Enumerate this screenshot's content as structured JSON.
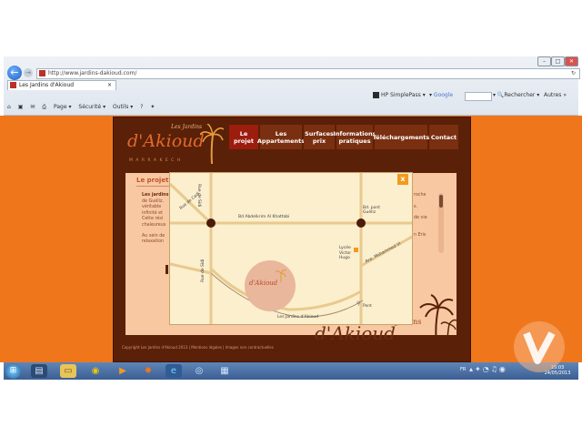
{
  "browser": {
    "address_url": "http://www.jardins-dakioud.com/",
    "tab_title": "Les Jardins d'Akioud",
    "tab_close": "×",
    "refresh_icon": "↻",
    "search_label": "Google",
    "search_button": "Rechercher",
    "others_label": "Autres »",
    "hp_label": "HP SimplePass",
    "commands": [
      "Page ▾",
      "Sécurité ▾",
      "Outils ▾"
    ]
  },
  "site": {
    "logo_small": "Les Jardins",
    "logo_script": "d'Akioud",
    "logo_sub": "M A R R A K E C H",
    "nav": [
      {
        "label": "Le projet",
        "active": true
      },
      {
        "label": "Les Appartements",
        "active": false
      },
      {
        "label": "Surfaces prix",
        "active": false
      },
      {
        "label": "Informations pratiques",
        "active": false
      },
      {
        "label": "Téléchargements",
        "active": false
      },
      {
        "label": "Contact",
        "active": false
      }
    ],
    "section_title": "Le projet",
    "body_lines": [
      "Les jardins",
      "de Guéliz,",
      "véritable",
      "infinité et",
      "Cette rési",
      "chaleureus",
      "Au sein de",
      "relaxation"
    ],
    "right_lines": [
      "roche",
      "s.",
      "de vie",
      "n Eris"
    ],
    "bottom_brand": "Les Jardins",
    "bottom_script": "d'Akioud",
    "footer": "Copyright Les Jardins d'Akioud 2013  |  Mentions légales  |  Images non contractuelles"
  },
  "map": {
    "close": "x",
    "roads": {
      "bd_abdelkrim": "Bd Abdelkrim Al Khattabi",
      "rue_sidi_1": "Rue de Sidi",
      "rue_sidi_2": "Rue de Sidi",
      "rue_cadi": "Rue de Cadi",
      "guelliz": "Bd. pont Guéliz",
      "mohammed": "Ave. Mohammed VI",
      "lycee": "Lycée Victor Hugo",
      "pont": "Pont",
      "bottom_road": "Les Jardins d'Akioud"
    },
    "marker_label": "d'Akioud"
  },
  "taskbar": {
    "lang": "FR",
    "time": "15:03",
    "date": "24/05/2013"
  },
  "colors": {
    "page_bg": "#f0761c",
    "site_dark": "#5a2008",
    "nav_active": "#9c1d0e",
    "map_bg": "#fbefcd",
    "road": "#e9c98e",
    "accent_orange": "#f39a1e"
  }
}
